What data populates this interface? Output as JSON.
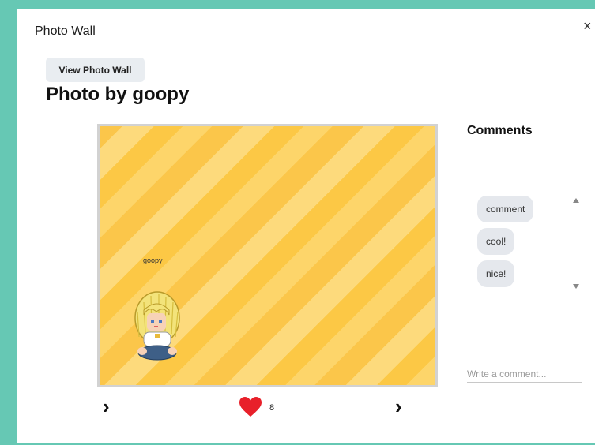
{
  "window": {
    "title": "Photo Wall",
    "close_glyph": "×"
  },
  "toolbar": {
    "view_wall_label": "View Photo Wall"
  },
  "photo": {
    "heading": "Photo by goopy",
    "player_name": "goopy",
    "colors": {
      "frame_accent": "#66c8b4",
      "stripe_a": "#fdd56a",
      "stripe_b": "#fcc845"
    }
  },
  "navigation": {
    "prev_glyph": "›",
    "next_glyph": "›"
  },
  "likes": {
    "count": "8",
    "heart_color": "#e8202a",
    "icon": "heart-icon"
  },
  "comments": {
    "title": "Comments",
    "items": [
      {
        "text": "comment"
      },
      {
        "text": "cool!"
      },
      {
        "text": "nice!"
      }
    ],
    "input_placeholder": "Write a comment..."
  }
}
